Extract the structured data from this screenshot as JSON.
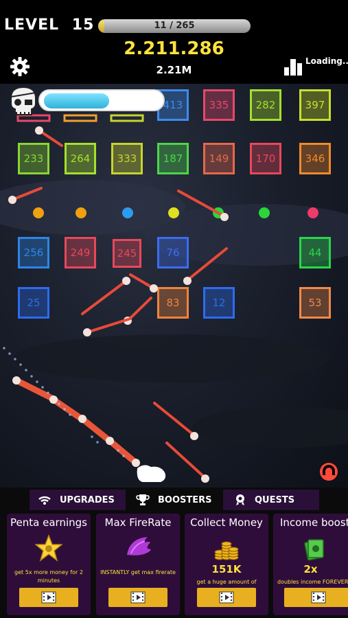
{
  "header": {
    "level_label": "LEVEL",
    "level_number": "15",
    "progress_text": "11 / 265",
    "progress_fraction": 0.0415,
    "score": "2.211.286",
    "score_short": "2.21M",
    "loading_label": "Loading.."
  },
  "boss": {
    "health_fraction": 0.55
  },
  "blocks": [
    {
      "value": "413",
      "color": "#3d8cf0"
    },
    {
      "value": "335",
      "color": "#e8486a"
    },
    {
      "value": "282",
      "color": "#a6e02c"
    },
    {
      "value": "397",
      "color": "#c8e02c"
    },
    {
      "value": "233",
      "color": "#8ad630"
    },
    {
      "value": "264",
      "color": "#a6e02c"
    },
    {
      "value": "333",
      "color": "#c8d42c"
    },
    {
      "value": "187",
      "color": "#4cd64a"
    },
    {
      "value": "149",
      "color": "#e8684a"
    },
    {
      "value": "170",
      "color": "#e8485a"
    },
    {
      "value": "346",
      "color": "#f08a2c"
    },
    {
      "value": "256",
      "color": "#2c86e8"
    },
    {
      "value": "249",
      "color": "#e8485a"
    },
    {
      "value": "245",
      "color": "#e8485a"
    },
    {
      "value": "76",
      "color": "#3d6cf0"
    },
    {
      "value": "44",
      "color": "#2cd64a"
    },
    {
      "value": "25",
      "color": "#2c6cf0"
    },
    {
      "value": "83",
      "color": "#f0843c"
    },
    {
      "value": "12",
      "color": "#2c6cf0"
    },
    {
      "value": "53",
      "color": "#f08a4a"
    }
  ],
  "tabs": [
    {
      "label": "UPGRADES",
      "icon": "wifi-icon"
    },
    {
      "label": "BOOSTERS",
      "icon": "trophy-icon"
    },
    {
      "label": "QUESTS",
      "icon": "badge-icon"
    }
  ],
  "cards": [
    {
      "title": "Penta earnings",
      "value": "",
      "desc": "get 5x more money for 2 minutes",
      "icon": "star-icon"
    },
    {
      "title": "Max FireRate",
      "value": "",
      "desc": "INSTANTLY get max firerate",
      "icon": "wing-icon"
    },
    {
      "title": "Collect Money",
      "value": "151K",
      "desc": "get a huge amount of money",
      "icon": "coins-icon"
    },
    {
      "title": "Income boost",
      "value": "2x",
      "desc": "doubles income FOREVER",
      "icon": "cash-icon"
    }
  ]
}
